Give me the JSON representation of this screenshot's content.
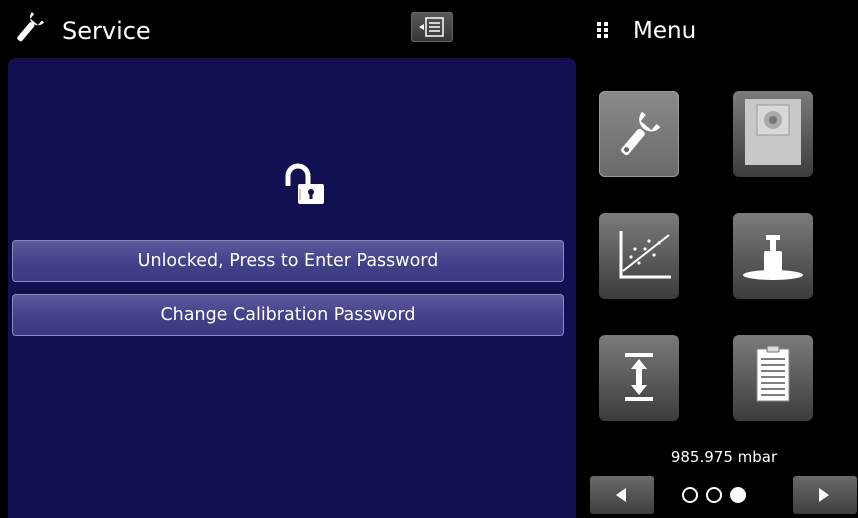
{
  "header": {
    "title": "Service",
    "icon": "wrench-icon",
    "toggle_icon": "list-toggle-icon"
  },
  "panel": {
    "lock_icon": "unlocked-padlock-icon",
    "buttons": [
      {
        "label": "Unlocked, Press to Enter Password"
      },
      {
        "label": "Change Calibration Password"
      }
    ]
  },
  "menu": {
    "title": "Menu",
    "icon": "grid-dots-icon",
    "tiles": [
      {
        "icon": "wrench-icon",
        "selected": true
      },
      {
        "icon": "speaker-icon",
        "selected": false
      },
      {
        "icon": "scatter-chart-icon",
        "selected": false
      },
      {
        "icon": "weight-icon",
        "selected": false
      },
      {
        "icon": "range-arrows-icon",
        "selected": false
      },
      {
        "icon": "document-icon",
        "selected": false
      }
    ],
    "pressure": "985.975 mbar",
    "page_indicator": {
      "pages": 3,
      "current": 3
    }
  },
  "colors": {
    "panel": "#111050",
    "button": "#46448c",
    "background": "#000000"
  }
}
